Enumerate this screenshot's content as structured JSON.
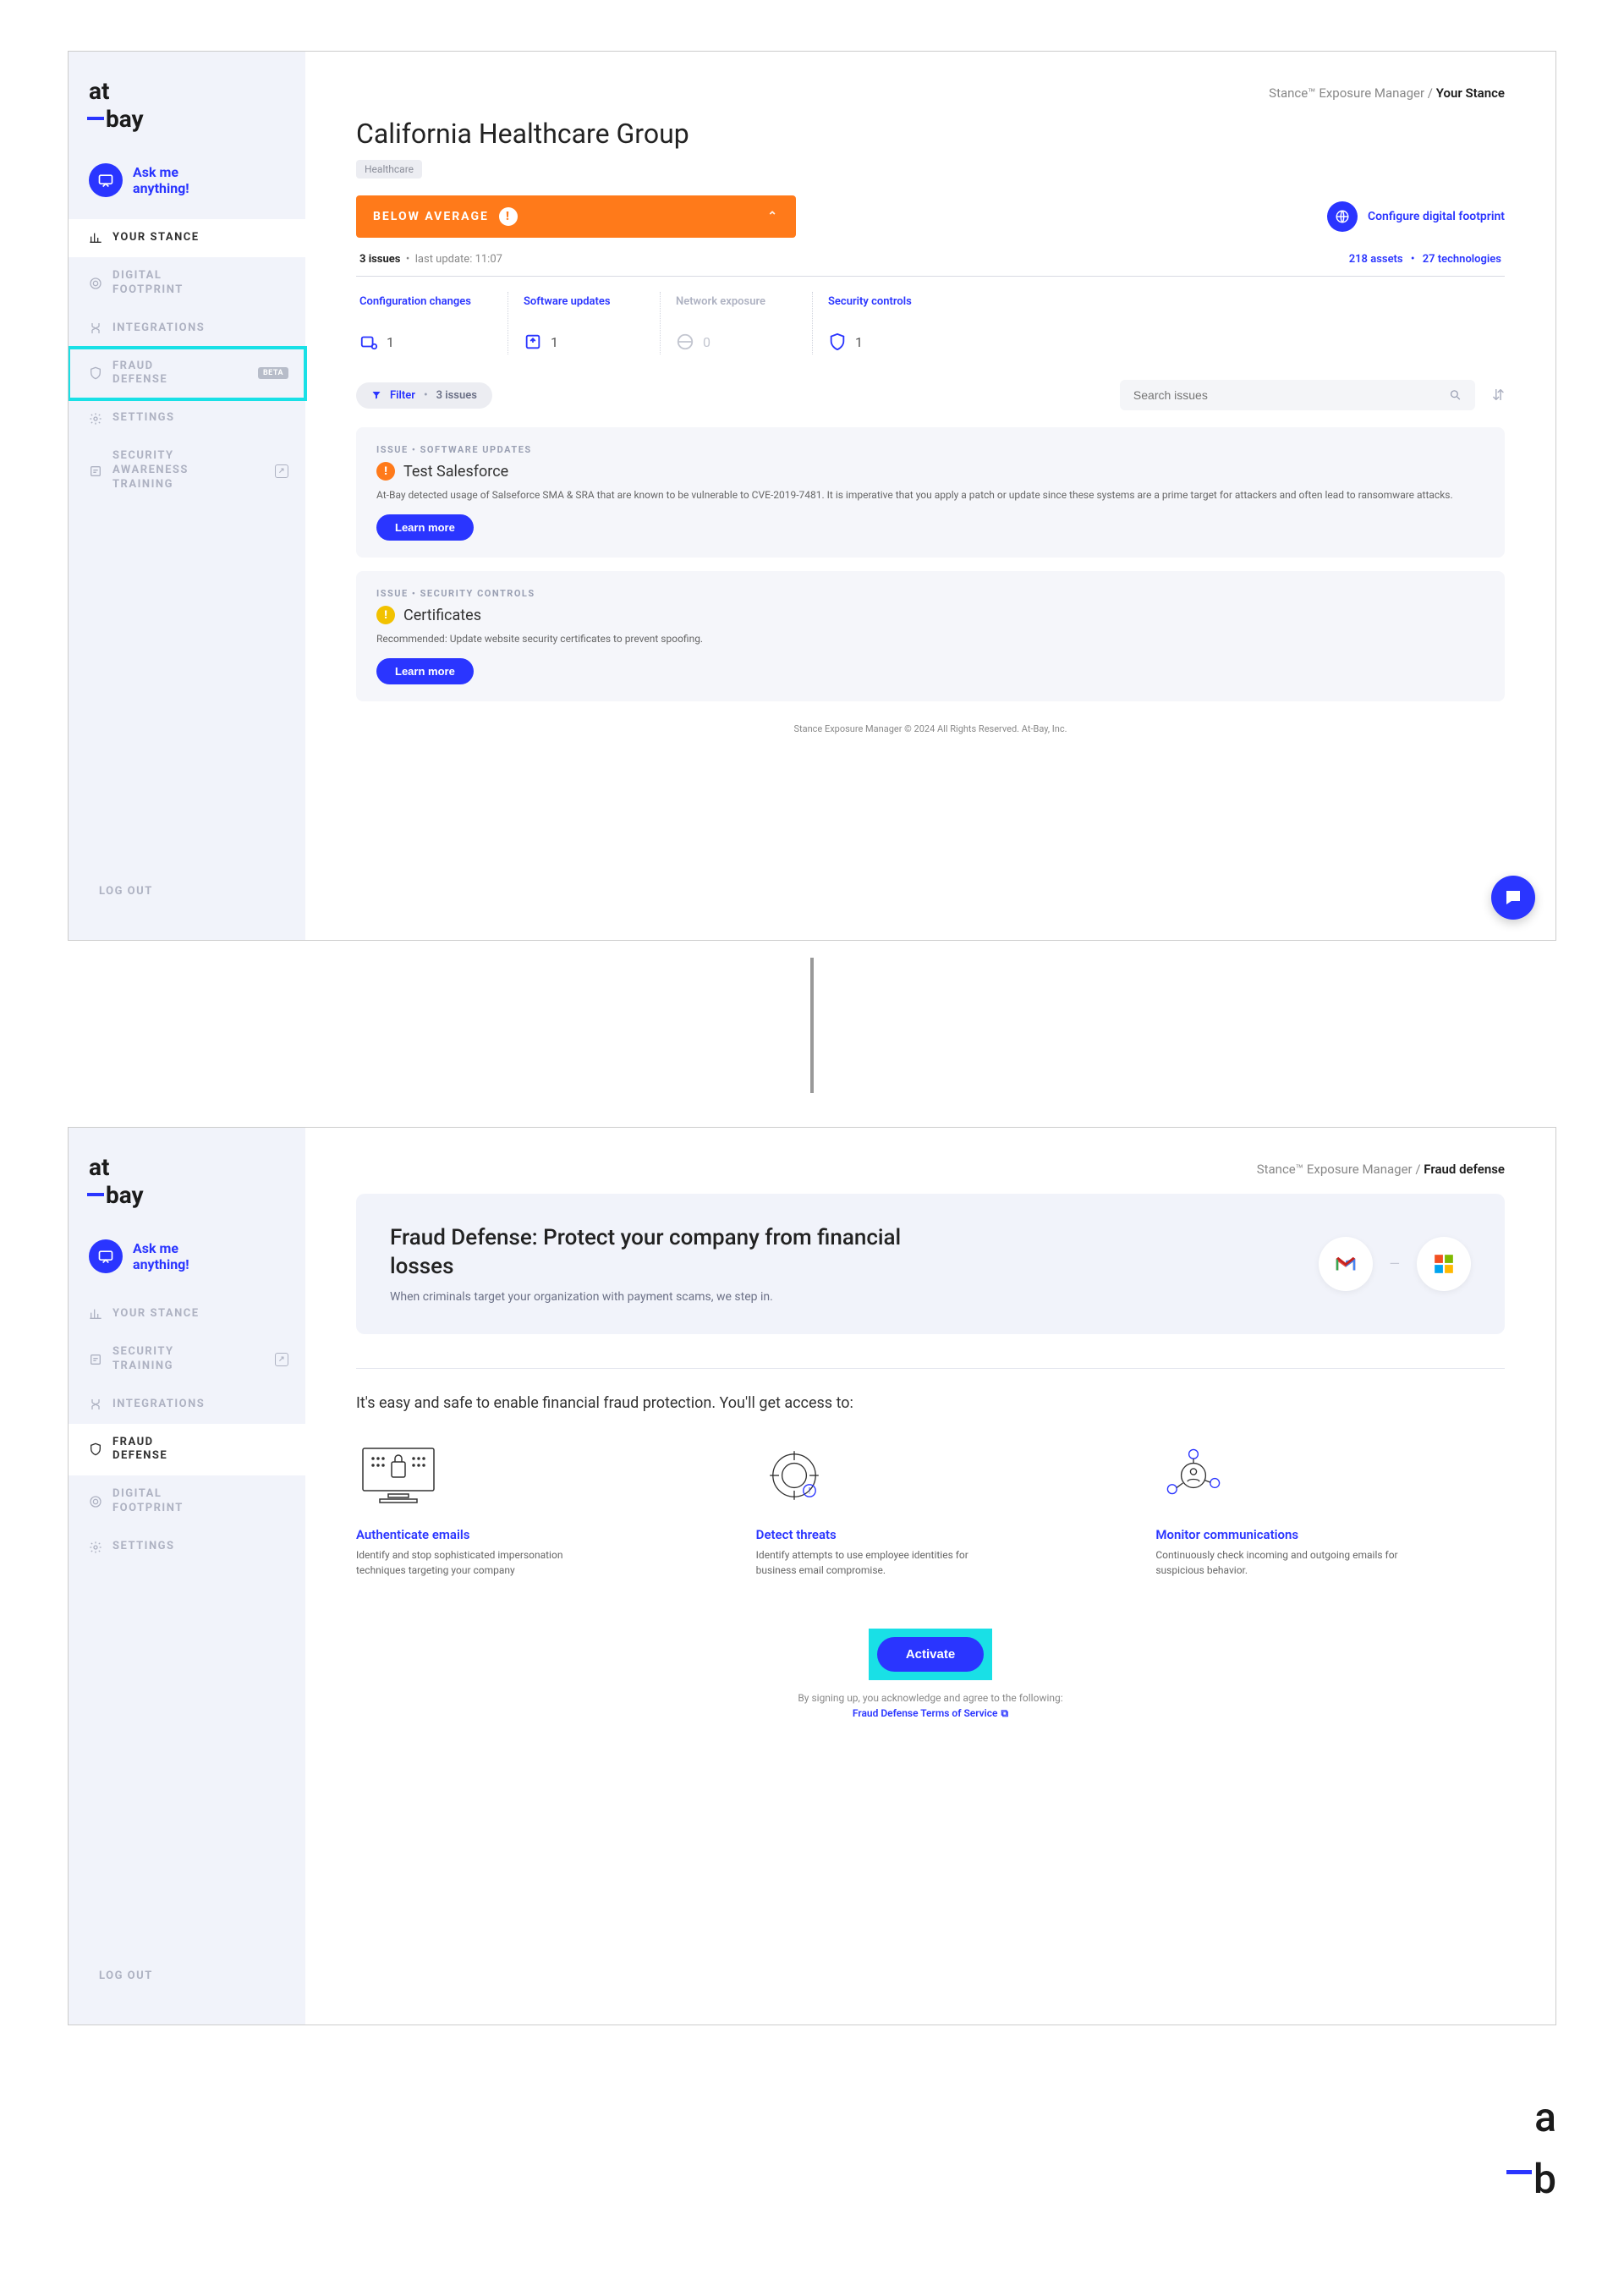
{
  "brand": {
    "at": "at",
    "bay": "bay"
  },
  "ask": {
    "line1": "Ask me",
    "line2": "anything!"
  },
  "frame1": {
    "nav": [
      {
        "label": "YOUR STANCE",
        "icon": "chart",
        "active": true
      },
      {
        "label": "DIGITAL FOOTPRINT",
        "icon": "footprint"
      },
      {
        "label": "INTEGRATIONS",
        "icon": "integrations"
      },
      {
        "label": "FRAUD DEFENSE",
        "icon": "shield",
        "badge": "BETA",
        "highlight": true
      },
      {
        "label": "SETTINGS",
        "icon": "gear"
      },
      {
        "label": "SECURITY AWARENESS TRAINING",
        "icon": "training",
        "ext": true
      }
    ],
    "logout": "LOG OUT",
    "breadcrumb": {
      "root": "Stance™ Exposure Manager",
      "sep": "/",
      "current": "Your Stance"
    },
    "title": "California Healthcare Group",
    "tag": "Healthcare",
    "banner": {
      "label": "BELOW AVERAGE"
    },
    "configure": "Configure digital footprint",
    "meta": {
      "issues": "3 issues",
      "updated": "last update: 11:07",
      "assets": "218 assets",
      "tech": "27 technologies"
    },
    "stats": [
      {
        "title": "Configuration changes",
        "val": "1",
        "muted": false
      },
      {
        "title": "Software updates",
        "val": "1",
        "muted": false
      },
      {
        "title": "Network exposure",
        "val": "0",
        "muted": true
      },
      {
        "title": "Security controls",
        "val": "1",
        "muted": false
      }
    ],
    "filter": {
      "label": "Filter",
      "count": "3 issues"
    },
    "search_placeholder": "Search issues",
    "issues": [
      {
        "kicker": "ISSUE  •  SOFTWARE UPDATES",
        "sev": "orange",
        "title": "Test Salesforce",
        "desc": "At-Bay detected usage of Salseforce SMA & SRA that are known to be vulnerable to CVE-2019-7481. It is imperative that you apply a patch or update since these systems are a prime target for attackers and often lead to ransomware attacks.",
        "btn": "Learn more"
      },
      {
        "kicker": "ISSUE  •  SECURITY CONTROLS",
        "sev": "yellow",
        "title": "Certificates",
        "desc": "Recommended: Update website security certificates to prevent spoofing.",
        "btn": "Learn more"
      }
    ],
    "footer": "Stance Exposure Manager © 2024 All Rights Reserved. At-Bay, Inc."
  },
  "frame2": {
    "nav": [
      {
        "label": "YOUR STANCE",
        "icon": "chart"
      },
      {
        "label": "SECURITY TRAINING",
        "icon": "training",
        "ext": true
      },
      {
        "label": "INTEGRATIONS",
        "icon": "integrations"
      },
      {
        "label": "FRAUD DEFENSE",
        "icon": "shield",
        "active": true
      },
      {
        "label": "DIGITAL FOOTPRINT",
        "icon": "footprint"
      },
      {
        "label": "SETTINGS",
        "icon": "gear"
      }
    ],
    "logout": "LOG OUT",
    "breadcrumb": {
      "root": "Stance™ Exposure Manager",
      "sep": "/",
      "current": "Fraud defense"
    },
    "hero": {
      "title": "Fraud Defense: Protect your company from financial losses",
      "sub": "When criminals target your organization with payment scams, we step in."
    },
    "easy": "It's easy and safe to enable financial fraud protection. You'll get access to:",
    "features": [
      {
        "title": "Authenticate emails",
        "desc": "Identify and stop sophisticated impersonation techniques targeting your company"
      },
      {
        "title": "Detect threats",
        "desc": "Identify attempts to use employee identities for business email compromise."
      },
      {
        "title": "Monitor communications",
        "desc": "Continuously check incoming and outgoing emails for suspicious behavior."
      }
    ],
    "activate": "Activate",
    "ack": "By signing up, you acknowledge and agree to the following:",
    "tos": "Fraud Defense Terms of Service"
  }
}
